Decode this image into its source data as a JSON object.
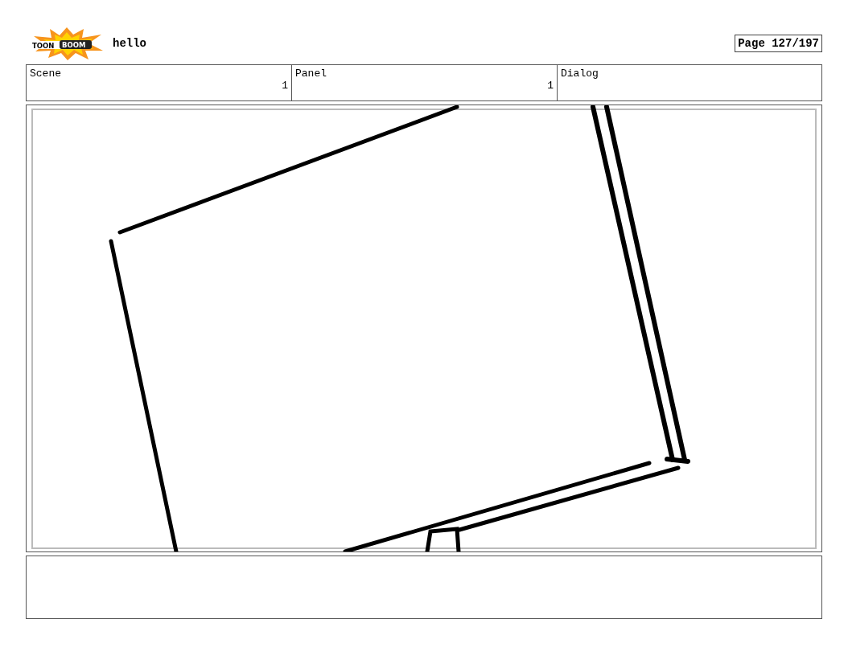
{
  "header": {
    "logo": {
      "left": "TOON",
      "right": "BOOM"
    },
    "title": "hello",
    "page": "Page 127/197"
  },
  "info": [
    {
      "heading": "Scene",
      "number": "1"
    },
    {
      "heading": "Panel",
      "number": "1"
    },
    {
      "heading": "Dialog"
    }
  ]
}
